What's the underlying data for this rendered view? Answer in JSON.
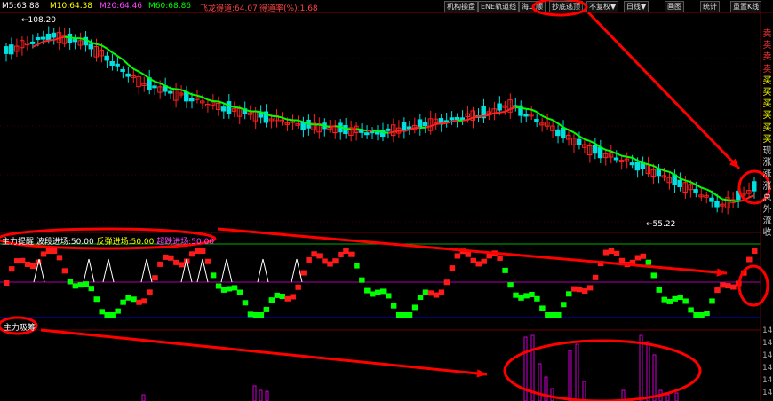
{
  "top_bar": {
    "ma5": "M5:63.88",
    "ma10": "M10:64.38",
    "ma20": "M20:64.46",
    "ma60": "M60:68.86",
    "extra1": "飞龙得道:64.07",
    "extra2": "得道率(%):1.68",
    "buttons": [
      "机构操盘",
      "ENE轨道线",
      "海二顺",
      "抄底逃顶",
      "不复权▼",
      "日线▼",
      "画图",
      "统计",
      "重置K线"
    ]
  },
  "main_chart": {
    "high_label": "←108.20",
    "low_label": "←55.22"
  },
  "side_labels": [
    "卖",
    "卖",
    "卖",
    "卖",
    "买",
    "买",
    "买",
    "买",
    "买",
    "买",
    "现",
    "涨",
    "涨",
    "涨",
    "总",
    "外",
    "流",
    "收"
  ],
  "indicator1": {
    "title": "主力提醒",
    "items": [
      {
        "text": "波段进场:50.00",
        "color": "#ffffff"
      },
      {
        "text": "反弹进场:50.00",
        "color": "#ffff00"
      },
      {
        "text": "超跌进场:50.00",
        "color": "#ff00ff"
      }
    ]
  },
  "indicator2": {
    "title": "主力吸筹",
    "axis_labels": [
      "14",
      "14",
      "14",
      "14",
      "14",
      "14"
    ]
  },
  "colors": {
    "up": "#ff2020",
    "down": "#00e0e0",
    "ma_green": "#00ff00",
    "ma_red": "#ff2020",
    "annotation": "#ff0000",
    "purple": "#cc00cc"
  }
}
